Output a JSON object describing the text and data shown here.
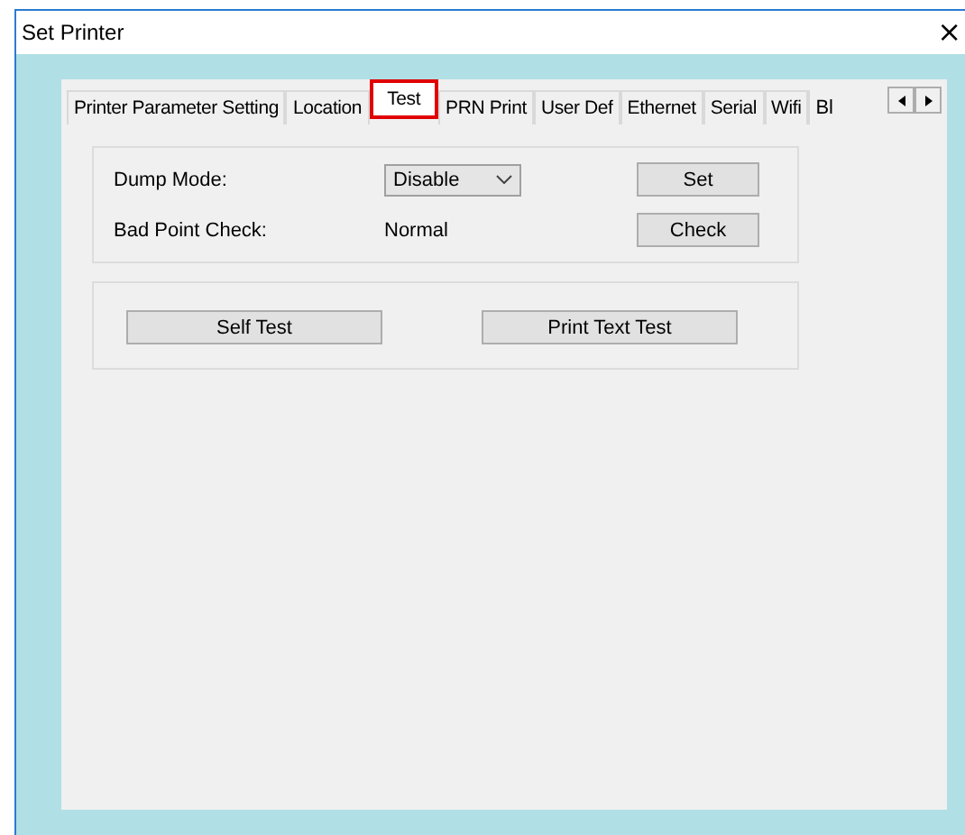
{
  "window": {
    "title": "Set Printer",
    "close": "×"
  },
  "tabs": [
    {
      "label": "Printer Parameter Setting",
      "selected": false
    },
    {
      "label": "Location",
      "selected": false
    },
    {
      "label": "Test",
      "selected": true
    },
    {
      "label": "PRN Print",
      "selected": false
    },
    {
      "label": "User Def",
      "selected": false
    },
    {
      "label": "Ethernet",
      "selected": false
    },
    {
      "label": "Serial",
      "selected": false
    },
    {
      "label": "Wifi",
      "selected": false
    },
    {
      "label": "Bl",
      "selected": false
    }
  ],
  "dump_mode": {
    "label": "Dump Mode:",
    "value": "Disable",
    "button": "Set"
  },
  "bad_point_check": {
    "label": "Bad Point Check:",
    "value": "Normal",
    "button": "Check"
  },
  "tests": [
    "Self Test",
    "Print Text Test"
  ]
}
